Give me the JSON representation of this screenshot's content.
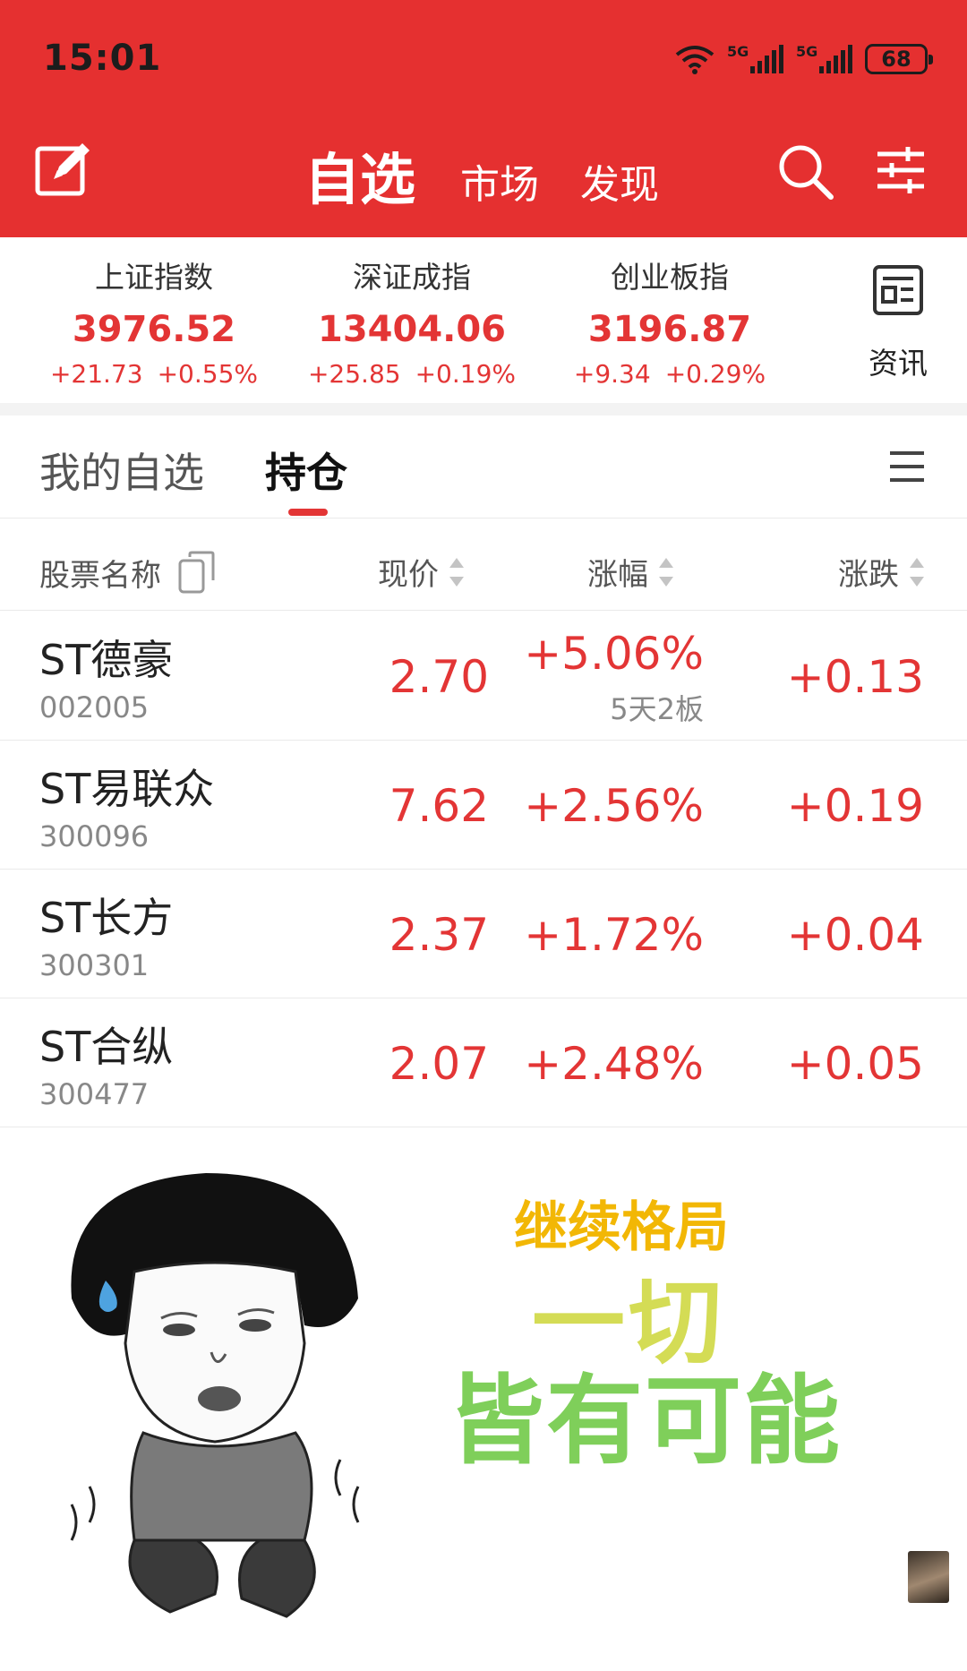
{
  "status_bar": {
    "time": "15:01",
    "signal1": "5G",
    "signal2": "5G",
    "battery": "68"
  },
  "header": {
    "tab_active": "自选",
    "tab_market": "市场",
    "tab_discover": "发现"
  },
  "indices": [
    {
      "name": "上证指数",
      "value": "3976.52",
      "change": "+21.73",
      "percent": "+0.55%"
    },
    {
      "name": "深证成指",
      "value": "13404.06",
      "change": "+25.85",
      "percent": "+0.19%"
    },
    {
      "name": "创业板指",
      "value": "3196.87",
      "change": "+9.34",
      "percent": "+0.29%"
    }
  ],
  "news": {
    "label": "资讯"
  },
  "tabs": {
    "watchlist": "我的自选",
    "holdings": "持仓"
  },
  "columns": {
    "name": "股票名称",
    "price": "现价",
    "percent": "涨幅",
    "change": "涨跌"
  },
  "rows": [
    {
      "name": "ST德豪",
      "code": "002005",
      "price": "2.70",
      "percent": "+5.06%",
      "note": "5天2板",
      "change": "+0.13"
    },
    {
      "name": "ST易联众",
      "code": "300096",
      "price": "7.62",
      "percent": "+2.56%",
      "change": "+0.19"
    },
    {
      "name": "ST长方",
      "code": "300301",
      "price": "2.37",
      "percent": "+1.72%",
      "change": "+0.04"
    },
    {
      "name": "ST合纵",
      "code": "300477",
      "price": "2.07",
      "percent": "+2.48%",
      "change": "+0.05"
    }
  ],
  "meme": {
    "line1": "继续格局",
    "line2": "一切",
    "line3": "皆有可能"
  },
  "colors": {
    "brand_red": "#e53030",
    "up_red": "#e33535"
  }
}
